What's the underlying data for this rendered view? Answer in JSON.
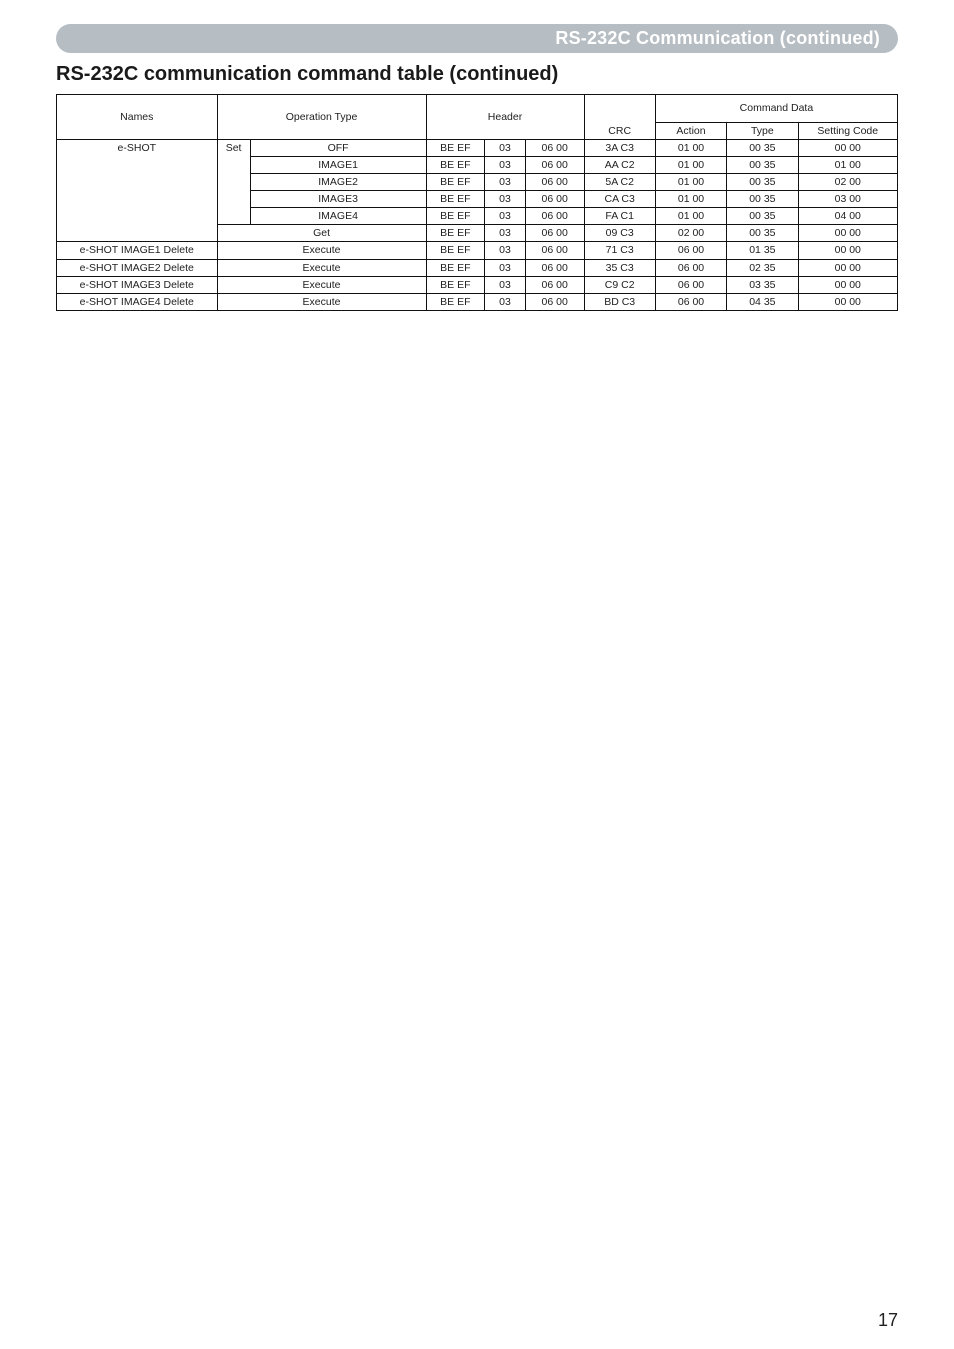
{
  "header_bar": "RS-232C Communication (continued)",
  "section_title": "RS-232C communication command table (continued)",
  "page_number": "17",
  "table": {
    "columns": {
      "names": "Names",
      "operation_type": "Operation Type",
      "header": "Header",
      "crc": "CRC",
      "command_data": "Command Data",
      "action": "Action",
      "type": "Type",
      "setting_code": "Setting Code"
    },
    "eshot_label": "e-SHOT",
    "set_label": "Set",
    "get_label": "Get",
    "execute_label": "Execute",
    "rows": [
      {
        "name": "",
        "op": "OFF",
        "h1": "BE EF",
        "h2": "03",
        "h3": "06 00",
        "crc": "3A C3",
        "act": "01 00",
        "type": "00 35",
        "code": "00 00"
      },
      {
        "name": "",
        "op": "IMAGE1",
        "h1": "BE EF",
        "h2": "03",
        "h3": "06 00",
        "crc": "AA C2",
        "act": "01 00",
        "type": "00 35",
        "code": "01 00"
      },
      {
        "name": "",
        "op": "IMAGE2",
        "h1": "BE EF",
        "h2": "03",
        "h3": "06 00",
        "crc": "5A C2",
        "act": "01 00",
        "type": "00 35",
        "code": "02 00"
      },
      {
        "name": "",
        "op": "IMAGE3",
        "h1": "BE EF",
        "h2": "03",
        "h3": "06 00",
        "crc": "CA C3",
        "act": "01 00",
        "type": "00 35",
        "code": "03 00"
      },
      {
        "name": "",
        "op": "IMAGE4",
        "h1": "BE EF",
        "h2": "03",
        "h3": "06 00",
        "crc": "FA C1",
        "act": "01 00",
        "type": "00 35",
        "code": "04 00"
      },
      {
        "name": "",
        "op": "Get",
        "h1": "BE EF",
        "h2": "03",
        "h3": "06 00",
        "crc": "09 C3",
        "act": "02 00",
        "type": "00 35",
        "code": "00 00"
      },
      {
        "name": "e-SHOT IMAGE1 Delete",
        "op": "Execute",
        "h1": "BE EF",
        "h2": "03",
        "h3": "06 00",
        "crc": "71 C3",
        "act": "06 00",
        "type": "01 35",
        "code": "00 00"
      },
      {
        "name": "e-SHOT IMAGE2 Delete",
        "op": "Execute",
        "h1": "BE EF",
        "h2": "03",
        "h3": "06 00",
        "crc": "35 C3",
        "act": "06 00",
        "type": "02 35",
        "code": "00 00"
      },
      {
        "name": "e-SHOT IMAGE3 Delete",
        "op": "Execute",
        "h1": "BE EF",
        "h2": "03",
        "h3": "06 00",
        "crc": "C9 C2",
        "act": "06 00",
        "type": "03 35",
        "code": "00 00"
      },
      {
        "name": "e-SHOT IMAGE4 Delete",
        "op": "Execute",
        "h1": "BE EF",
        "h2": "03",
        "h3": "06 00",
        "crc": "BD C3",
        "act": "06 00",
        "type": "04 35",
        "code": "00 00"
      }
    ]
  }
}
